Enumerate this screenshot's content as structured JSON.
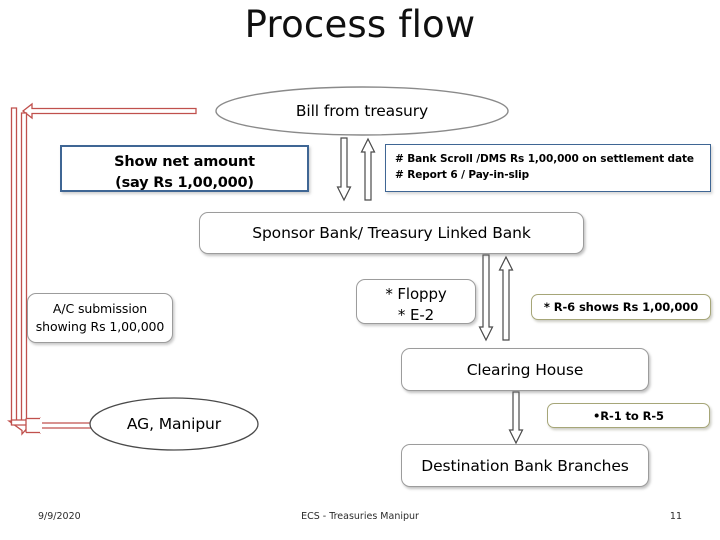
{
  "slide": {
    "title": "Process flow"
  },
  "nodes": {
    "bill_from_treasury": "Bill from treasury",
    "show_net_amount_line1": "Show net amount",
    "show_net_amount_line2": "(say  Rs 1,00,000)",
    "bank_scroll_line1": "# Bank Scroll /DMS Rs 1,00,000 on settlement date",
    "bank_scroll_line2": "# Report 6 / Pay-in-slip",
    "sponsor_bank": "Sponsor Bank/ Treasury Linked Bank",
    "floppy_line1": "* Floppy",
    "floppy_line2": "* E-2",
    "r6_note": "* R-6 shows Rs 1,00,000",
    "ac_submission_line1": "A/C submission",
    "ac_submission_line2": "showing Rs 1,00,000",
    "clearing_house": "Clearing House",
    "r1_to_r5_note": "•R-1 to R-5",
    "ag_manipur": "AG, Manipur",
    "destination_bank_branches": "Destination Bank Branches"
  },
  "footer": {
    "date": "9/9/2020",
    "label": "ECS - Treasuries Manipur",
    "page": "11"
  },
  "colors": {
    "red_arrow": "#c0504d",
    "blue_border": "#3f6694",
    "olive_border": "#a6a678",
    "gray_border": "#9c9c9c",
    "text": "#000000"
  }
}
